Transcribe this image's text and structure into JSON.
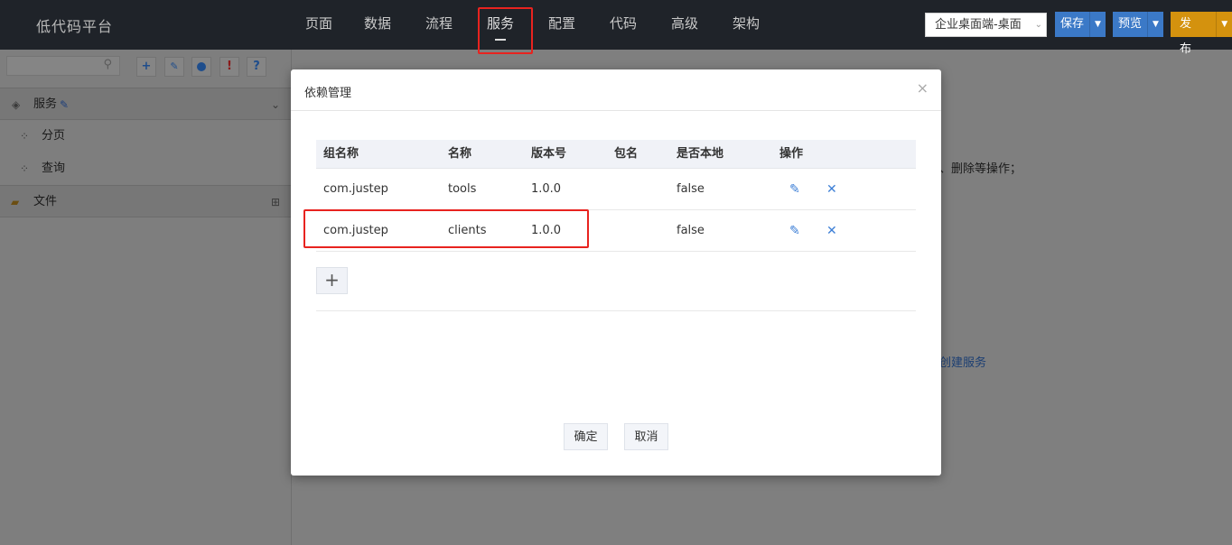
{
  "app": {
    "title": "低代码平台"
  },
  "nav": [
    "页面",
    "数据",
    "流程",
    "服务",
    "配置",
    "代码",
    "高级",
    "架构"
  ],
  "nav_active": "服务",
  "platform_select": "企业桌面端-桌面",
  "actions": {
    "save": "保存",
    "preview": "预览",
    "publish": "发布"
  },
  "left_tree": {
    "section_service": "服务",
    "items": [
      "分页",
      "查询"
    ],
    "section_file": "文件"
  },
  "background": {
    "hint_text": "、删除等操作；",
    "create_link": "创建服务"
  },
  "modal": {
    "title": "依赖管理",
    "columns": [
      "组名称",
      "名称",
      "版本号",
      "包名",
      "是否本地",
      "操作"
    ],
    "rows": [
      {
        "group": "com.justep",
        "name": "tools",
        "version": "1.0.0",
        "package": "",
        "local": "false"
      },
      {
        "group": "com.justep",
        "name": "clients",
        "version": "1.0.0",
        "package": "",
        "local": "false"
      }
    ],
    "add_symbol": "+",
    "confirm": "确定",
    "cancel": "取消"
  },
  "colors": {
    "accent_blue": "#3b79c7",
    "publish_gold": "#d4920e",
    "highlight_red": "#e8231f"
  }
}
